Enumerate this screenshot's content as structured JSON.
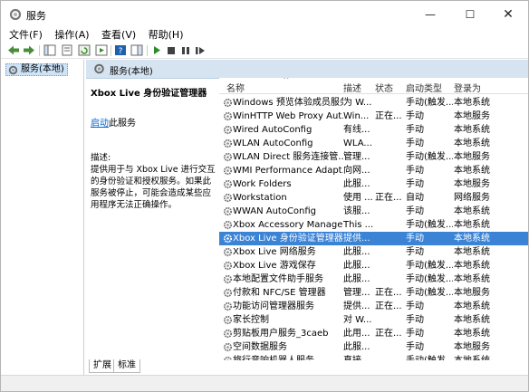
{
  "window": {
    "title": "服务"
  },
  "menu": [
    "文件(F)",
    "操作(A)",
    "查看(V)",
    "帮助(H)"
  ],
  "tree": {
    "root": "服务(本地)"
  },
  "header": {
    "title": "服务(本地)"
  },
  "description": {
    "service_name": "Xbox Live 身份验证管理器",
    "start_link": "启动",
    "start_suffix": "此服务",
    "label": "描述:",
    "text": "提供用于与 Xbox Live 进行交互的身份验证和授权服务。如果此服务被停止，可能会造成某些应用程序无法正确操作。"
  },
  "columns": [
    "名称",
    "描述",
    "状态",
    "启动类型",
    "登录为"
  ],
  "rows": [
    {
      "name": "Windows 预览体验成员服务",
      "desc": "为 W...",
      "status": "",
      "startup": "手动(触发...",
      "logon": "本地系统"
    },
    {
      "name": "WinHTTP Web Proxy Aut...",
      "desc": "Win...",
      "status": "正在...",
      "startup": "手动",
      "logon": "本地服务"
    },
    {
      "name": "Wired AutoConfig",
      "desc": "有线...",
      "status": "",
      "startup": "手动",
      "logon": "本地系统"
    },
    {
      "name": "WLAN AutoConfig",
      "desc": "WLA...",
      "status": "",
      "startup": "手动",
      "logon": "本地系统"
    },
    {
      "name": "WLAN Direct 服务连接管...",
      "desc": "管理...",
      "status": "",
      "startup": "手动(触发...",
      "logon": "本地服务"
    },
    {
      "name": "WMI Performance Adapt...",
      "desc": "向网...",
      "status": "",
      "startup": "手动",
      "logon": "本地系统"
    },
    {
      "name": "Work Folders",
      "desc": "此服...",
      "status": "",
      "startup": "手动",
      "logon": "本地服务"
    },
    {
      "name": "Workstation",
      "desc": "使用 ...",
      "status": "正在...",
      "startup": "自动",
      "logon": "网络服务"
    },
    {
      "name": "WWAN AutoConfig",
      "desc": "该服...",
      "status": "",
      "startup": "手动",
      "logon": "本地系统"
    },
    {
      "name": "Xbox Accessory Manage...",
      "desc": "This ...",
      "status": "",
      "startup": "手动(触发...",
      "logon": "本地系统"
    },
    {
      "name": "Xbox Live 身份验证管理器",
      "desc": "提供...",
      "status": "",
      "startup": "手动",
      "logon": "本地系统",
      "selected": true
    },
    {
      "name": "Xbox Live 网络服务",
      "desc": "此服...",
      "status": "",
      "startup": "手动",
      "logon": "本地系统"
    },
    {
      "name": "Xbox Live 游戏保存",
      "desc": "此服...",
      "status": "",
      "startup": "手动(触发...",
      "logon": "本地系统"
    },
    {
      "name": "本地配置文件助手服务",
      "desc": "此服...",
      "status": "",
      "startup": "手动(触发...",
      "logon": "本地系统"
    },
    {
      "name": "付款和 NFC/SE 管理器",
      "desc": "管理...",
      "status": "正在...",
      "startup": "手动(触发...",
      "logon": "本地服务"
    },
    {
      "name": "功能访问管理器服务",
      "desc": "提供...",
      "status": "正在...",
      "startup": "手动",
      "logon": "本地系统"
    },
    {
      "name": "家长控制",
      "desc": "对 W...",
      "status": "",
      "startup": "手动",
      "logon": "本地系统"
    },
    {
      "name": "剪贴板用户服务_3caeb",
      "desc": "此用...",
      "status": "正在...",
      "startup": "手动",
      "logon": "本地系统"
    },
    {
      "name": "空间数据服务",
      "desc": "此服...",
      "status": "",
      "startup": "手动",
      "logon": "本地服务"
    },
    {
      "name": "旅行音响机器人服务",
      "desc": "直接...",
      "status": "",
      "startup": "手动(触发...",
      "logon": "本地系统"
    }
  ],
  "tabs": [
    "扩展",
    "标准"
  ]
}
